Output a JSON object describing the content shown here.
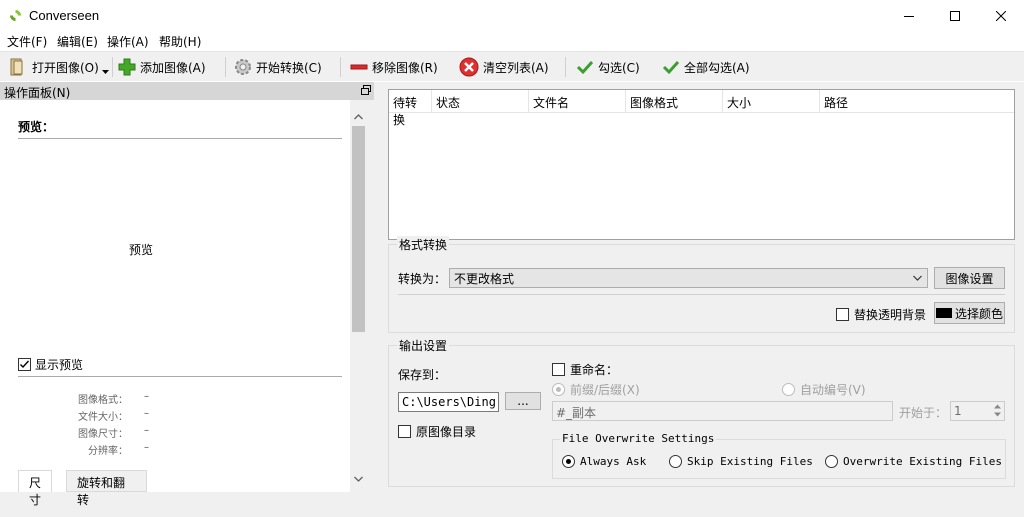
{
  "window": {
    "title": "Converseen",
    "icon": "converseen-app-icon",
    "min_icon": "minimize-icon",
    "max_icon": "maximize-icon",
    "close_icon": "close-icon"
  },
  "menu": [
    "文件(F)",
    "编辑(E)",
    "操作(A)",
    "帮助(H)"
  ],
  "toolbar": {
    "open": "打开图像(O)",
    "add": "添加图像(A)",
    "convert": "开始转换(C)",
    "remove": "移除图像(R)",
    "clear": "清空列表(A)",
    "check": "勾选(C)",
    "check_all": "全部勾选(A)"
  },
  "dock": {
    "title": "操作面板(N)",
    "preview_title": "预览：",
    "preview_placeholder": "预览",
    "show_preview_label": "显示预览",
    "show_preview_checked": true,
    "info": [
      {
        "label": "图像格式：",
        "value": "–"
      },
      {
        "label": "文件大小：",
        "value": "–"
      },
      {
        "label": "图像尺寸：",
        "value": "–"
      },
      {
        "label": "分辨率：",
        "value": "–"
      }
    ],
    "tabs": [
      "尺寸",
      "旋转和翻转"
    ]
  },
  "table": {
    "columns": [
      "待转换",
      "状态",
      "文件名",
      "图像格式",
      "大小",
      "路径"
    ],
    "rows": []
  },
  "format": {
    "group_title": "格式转换",
    "convert_to_label": "转换为：",
    "convert_to_value": "不更改格式",
    "image_settings_button": "图像设置",
    "transparent_bg_label": "替换透明背景",
    "transparent_bg_checked": false,
    "choose_color_button": "选择颜色",
    "swatch_color": "#000000"
  },
  "output": {
    "group_title": "输出设置",
    "save_to_label": "保存到：",
    "save_path": "C:\\Users\\Ding",
    "browse_button": "...",
    "original_dir_label": "原图像目录",
    "original_dir_checked": false,
    "rename_label": "重命名：",
    "rename_checked": false,
    "prefix_suffix_label": "前缀/后缀(X)",
    "auto_number_label": "自动编号(V)",
    "rename_pattern": "#_副本",
    "start_at_label": "开始于：",
    "start_at_value": "1",
    "overwrite_title": "File Overwrite Settings",
    "overwrite_options": [
      "Always Ask",
      "Skip Existing Files",
      "Overwrite Existing Files"
    ],
    "overwrite_selected": 0
  }
}
